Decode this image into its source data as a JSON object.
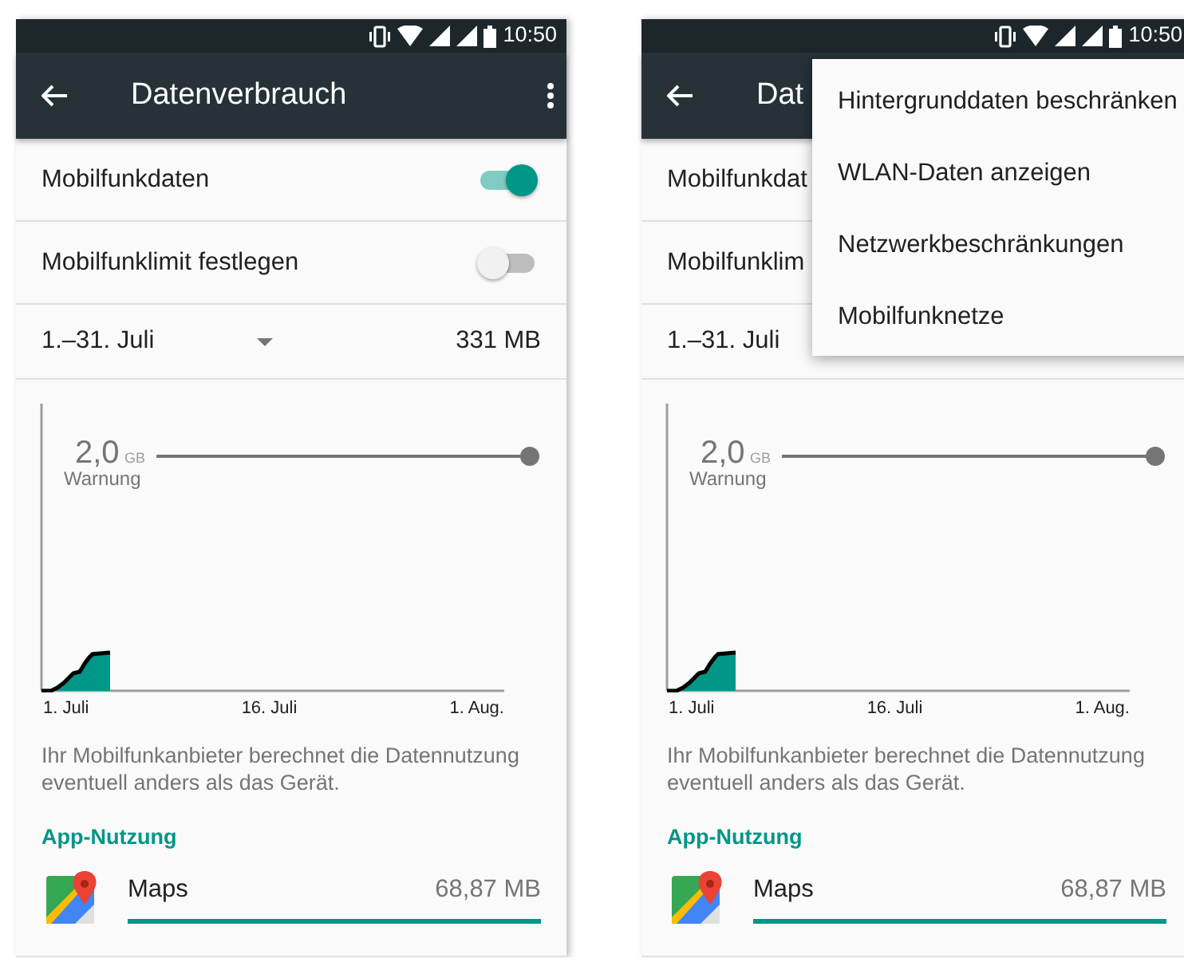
{
  "screens": [
    {
      "status_bar": {
        "time": "10:50"
      },
      "toolbar": {
        "title": "Datenverbrauch"
      },
      "rows": [
        {
          "kind": "switch",
          "label": "Mobilfunkdaten",
          "on": true
        },
        {
          "kind": "switch",
          "label": "Mobilfunklimit festlegen",
          "on": false
        },
        {
          "kind": "period",
          "label": "1.–31. Juli",
          "dropdown": true,
          "value": "331 MB"
        }
      ],
      "chart": {
        "warning_value": "2,0",
        "warning_unit": "GB",
        "warning_label": "Warnung",
        "x_labels": [
          "1. Juli",
          "16. Juli",
          "1. Aug."
        ]
      },
      "note": "Ihr Mobilfunkanbieter berechnet die Datennutzung eventuell anders als das Gerät.",
      "section_title": "App-Nutzung",
      "apps": [
        {
          "name": "Maps",
          "usage": "68,87 MB",
          "level": 1
        }
      ]
    },
    {
      "status_bar": {
        "time": "10:50"
      },
      "toolbar": {
        "title": "Dat"
      },
      "rows": [
        {
          "kind": "switch",
          "label": "Mobilfunkdat"
        },
        {
          "kind": "switch",
          "label": "Mobilfunklim"
        },
        {
          "kind": "period",
          "label": "1.–31. Juli"
        }
      ],
      "chart": {
        "warning_value": "2,0",
        "warning_unit": "GB",
        "warning_label": "Warnung",
        "x_labels": [
          "1. Juli",
          "16. Juli",
          "1. Aug."
        ]
      },
      "note": "Ihr Mobilfunkanbieter berechnet die Datennutzung eventuell anders als das Gerät.",
      "section_title": "App-Nutzung",
      "apps": [
        {
          "name": "Maps",
          "usage": "68,87 MB",
          "level": 1
        }
      ],
      "overflow_menu": [
        "Hintergrunddaten beschränken",
        "WLAN-Daten anzeigen",
        "Netzwerkbeschränkungen",
        "Mobilfunknetze"
      ]
    }
  ]
}
